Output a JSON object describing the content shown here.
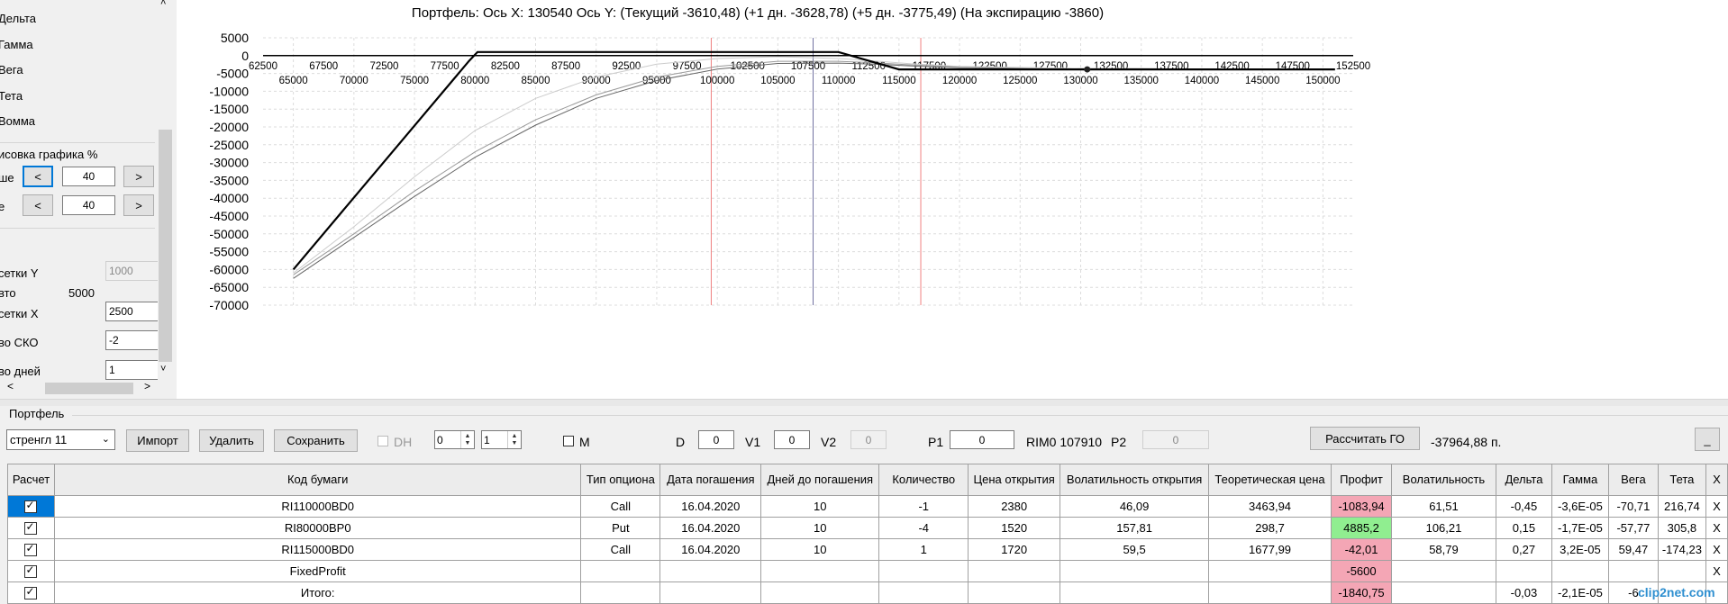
{
  "left_panel": {
    "greeks": [
      "Дельта",
      "Гамма",
      "Вега",
      "Тета",
      "Вомма"
    ],
    "plot_section_label": "исовка графика %",
    "upper": {
      "label": "ше",
      "dec": "<",
      "value": "40",
      "inc": ">"
    },
    "lower": {
      "label": "е",
      "dec": "<",
      "value": "40",
      "inc": ">"
    },
    "grid_y": {
      "label": "сетки Y",
      "value": "1000"
    },
    "auto": {
      "label": "вто",
      "value": "5000"
    },
    "grid_x": {
      "label": "сетки X",
      "value": "2500"
    },
    "sko": {
      "label": "во СКО",
      "value": "-2"
    },
    "days": {
      "label": "во дней",
      "value": "1"
    },
    "scroll_up": "˄",
    "scroll_down": "˅",
    "scroll_left": "<",
    "scroll_right": ">"
  },
  "chart_data": {
    "type": "line",
    "title": "Портфель: Ось X: 130540 Ось Y:  (Текущий -3610,48)  (+1 дн. -3628,78)  (+5 дн. -3775,49)  (На экспирацию -3860)",
    "ylim": [
      -70000,
      5000
    ],
    "y_ticks": [
      5000,
      0,
      -5000,
      -10000,
      -15000,
      -20000,
      -25000,
      -30000,
      -35000,
      -40000,
      -45000,
      -50000,
      -55000,
      -60000,
      -65000,
      -70000
    ],
    "y_tick_labels": [
      "5000",
      "0",
      "-5000",
      "-10000",
      "-15000",
      "-20000",
      "-25000",
      "-30000",
      "-35000",
      "-40000",
      "-45000",
      "-50000",
      "-55000",
      "-60000",
      "-65000",
      "-70000"
    ],
    "xlim": [
      62500,
      152500
    ],
    "x_ticks_top": [
      62500,
      67500,
      72500,
      77500,
      82500,
      87500,
      92500,
      97500,
      102500,
      107500,
      112500,
      117500,
      122500,
      127500,
      132500,
      137500,
      142500,
      147500,
      152500
    ],
    "x_tick_labels_top": [
      "62500",
      "67500",
      "72500",
      "77500",
      "82500",
      "87500",
      "92500",
      "97500",
      "102500",
      "107500",
      "112500",
      "117500",
      "122500",
      "127500",
      "132500",
      "137500",
      "142500",
      "147500",
      "152500"
    ],
    "x_ticks_bottom": [
      65000,
      70000,
      75000,
      80000,
      85000,
      90000,
      95000,
      100000,
      105000,
      110000,
      115000,
      120000,
      125000,
      130000,
      135000,
      140000,
      145000,
      150000
    ],
    "x_tick_labels_bottom": [
      "65000",
      "70000",
      "75000",
      "80000",
      "85000",
      "90000",
      "95000",
      "100000",
      "105000",
      "110000",
      "115000",
      "120000",
      "125000",
      "130000",
      "135000",
      "140000",
      "145000",
      "150000"
    ],
    "grid": true,
    "vlines": [
      {
        "x": 99500,
        "color": "#f08080"
      },
      {
        "x": 107910,
        "color": "#7070a0"
      },
      {
        "x": 116800,
        "color": "#f08080"
      }
    ],
    "marker": {
      "x": 130540,
      "y": -3860
    },
    "series": [
      {
        "color": "#000000",
        "width": 2.2,
        "x": [
          65000,
          79500,
          80200,
          110000,
          115000,
          151000
        ],
        "y": [
          -60000,
          -1500,
          1000,
          1000,
          -3860,
          -3860
        ]
      },
      {
        "color": "#cccccc",
        "width": 1,
        "x": [
          65000,
          70000,
          75000,
          80000,
          85000,
          90000,
          95000,
          100000,
          105000,
          110000,
          113000,
          116000,
          120000,
          130000,
          151000
        ],
        "y": [
          -61000,
          -48000,
          -34000,
          -21000,
          -12000,
          -6000,
          -2400,
          -800,
          -300,
          -800,
          -1500,
          -2300,
          -3000,
          -3600,
          -3850
        ]
      },
      {
        "color": "#999999",
        "width": 1,
        "x": [
          65000,
          70000,
          75000,
          80000,
          85000,
          90000,
          95000,
          100000,
          105000,
          110000,
          113000,
          116000,
          120000,
          130000,
          151000
        ],
        "y": [
          -61500,
          -50000,
          -38000,
          -27000,
          -18000,
          -11000,
          -6000,
          -3000,
          -1600,
          -1600,
          -2000,
          -2600,
          -3200,
          -3620,
          -3860
        ]
      },
      {
        "color": "#666666",
        "width": 1,
        "x": [
          65000,
          70000,
          75000,
          80000,
          85000,
          90000,
          95000,
          100000,
          105000,
          110000,
          113000,
          116000,
          120000,
          130000,
          151000
        ],
        "y": [
          -62500,
          -51000,
          -39500,
          -28500,
          -19500,
          -12000,
          -7000,
          -3800,
          -2200,
          -2100,
          -2400,
          -2900,
          -3400,
          -3640,
          -3860
        ]
      }
    ]
  },
  "portfolio": {
    "label": "Портфель",
    "selector": "стренгл 11",
    "import_button": "Импорт",
    "delete_button": "Удалить",
    "save_button": "Сохранить",
    "dh_label": "DH",
    "spin1": "0",
    "spin2": "1",
    "m_label": "M",
    "d_label": "D",
    "d_value": "0",
    "v1_label": "V1",
    "v1_value": "0",
    "v2_label": "V2",
    "v2_value": "0",
    "p1_label": "P1",
    "p1_value": "0",
    "rim_label": "RIM0 107910",
    "p2_label": "P2",
    "p2_value": "0",
    "calc_go_button": "Рассчитать ГО",
    "go_value": "-37964,88 п.",
    "minimize_button": "_"
  },
  "grid": {
    "headers": [
      "Расчет",
      "Код бумаги",
      "Тип опциона",
      "Дата погашения",
      "Дней до погашения",
      "Количество",
      "Цена открытия",
      "Волатильность открытия",
      "Теоретическая цена",
      "Профит",
      "Волатильность",
      "Дельта",
      "Гамма",
      "Вега",
      "Тета",
      "X"
    ],
    "rows": [
      [
        "",
        "RI110000BD0",
        "Call",
        "16.04.2020",
        "10",
        "-1",
        "2380",
        "46,09",
        "3463,94",
        "-1083,94",
        "61,51",
        "-0,45",
        "-3,6E-05",
        "-70,71",
        "216,74",
        "X"
      ],
      [
        "",
        "RI80000BP0",
        "Put",
        "16.04.2020",
        "10",
        "-4",
        "1520",
        "157,81",
        "298,7",
        "4885,2",
        "106,21",
        "0,15",
        "-1,7E-05",
        "-57,77",
        "305,8",
        "X"
      ],
      [
        "",
        "RI115000BD0",
        "Call",
        "16.04.2020",
        "10",
        "1",
        "1720",
        "59,5",
        "1677,99",
        "-42,01",
        "58,79",
        "0,27",
        "3,2E-05",
        "59,47",
        "-174,23",
        "X"
      ],
      [
        "",
        "FixedProfit",
        "",
        "",
        "",
        "",
        "",
        "",
        "",
        "-5600",
        "",
        "",
        "",
        "",
        "",
        "X"
      ],
      [
        "",
        "Итого:",
        "",
        "",
        "",
        "",
        "",
        "",
        "",
        "-1840,75",
        "",
        "-0,03",
        "-2,1E-05",
        "-6",
        "",
        ""
      ]
    ]
  },
  "watermark": "clip2net.com"
}
